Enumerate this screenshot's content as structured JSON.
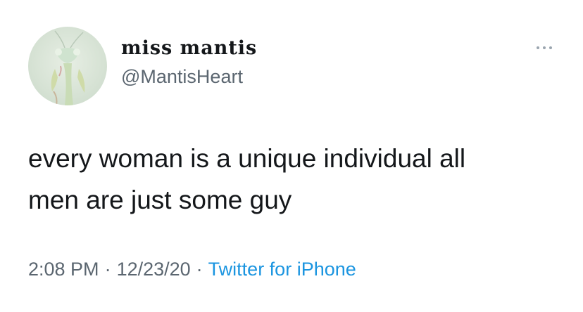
{
  "tweet": {
    "author": {
      "display_name": "miss mantis",
      "handle": "@MantisHeart",
      "avatar_icon": "praying-mantis-avatar"
    },
    "more_icon": "more-horizontal-icon",
    "text_lines": [
      "every woman is a unique individual all",
      "men are just some guy"
    ],
    "time": "2:08 PM",
    "date": "12/23/20",
    "separator": "·",
    "source": "Twitter for iPhone"
  },
  "colors": {
    "text": "#14171a",
    "secondary": "#5b6670",
    "link": "#1b95e0",
    "background": "#ffffff"
  }
}
